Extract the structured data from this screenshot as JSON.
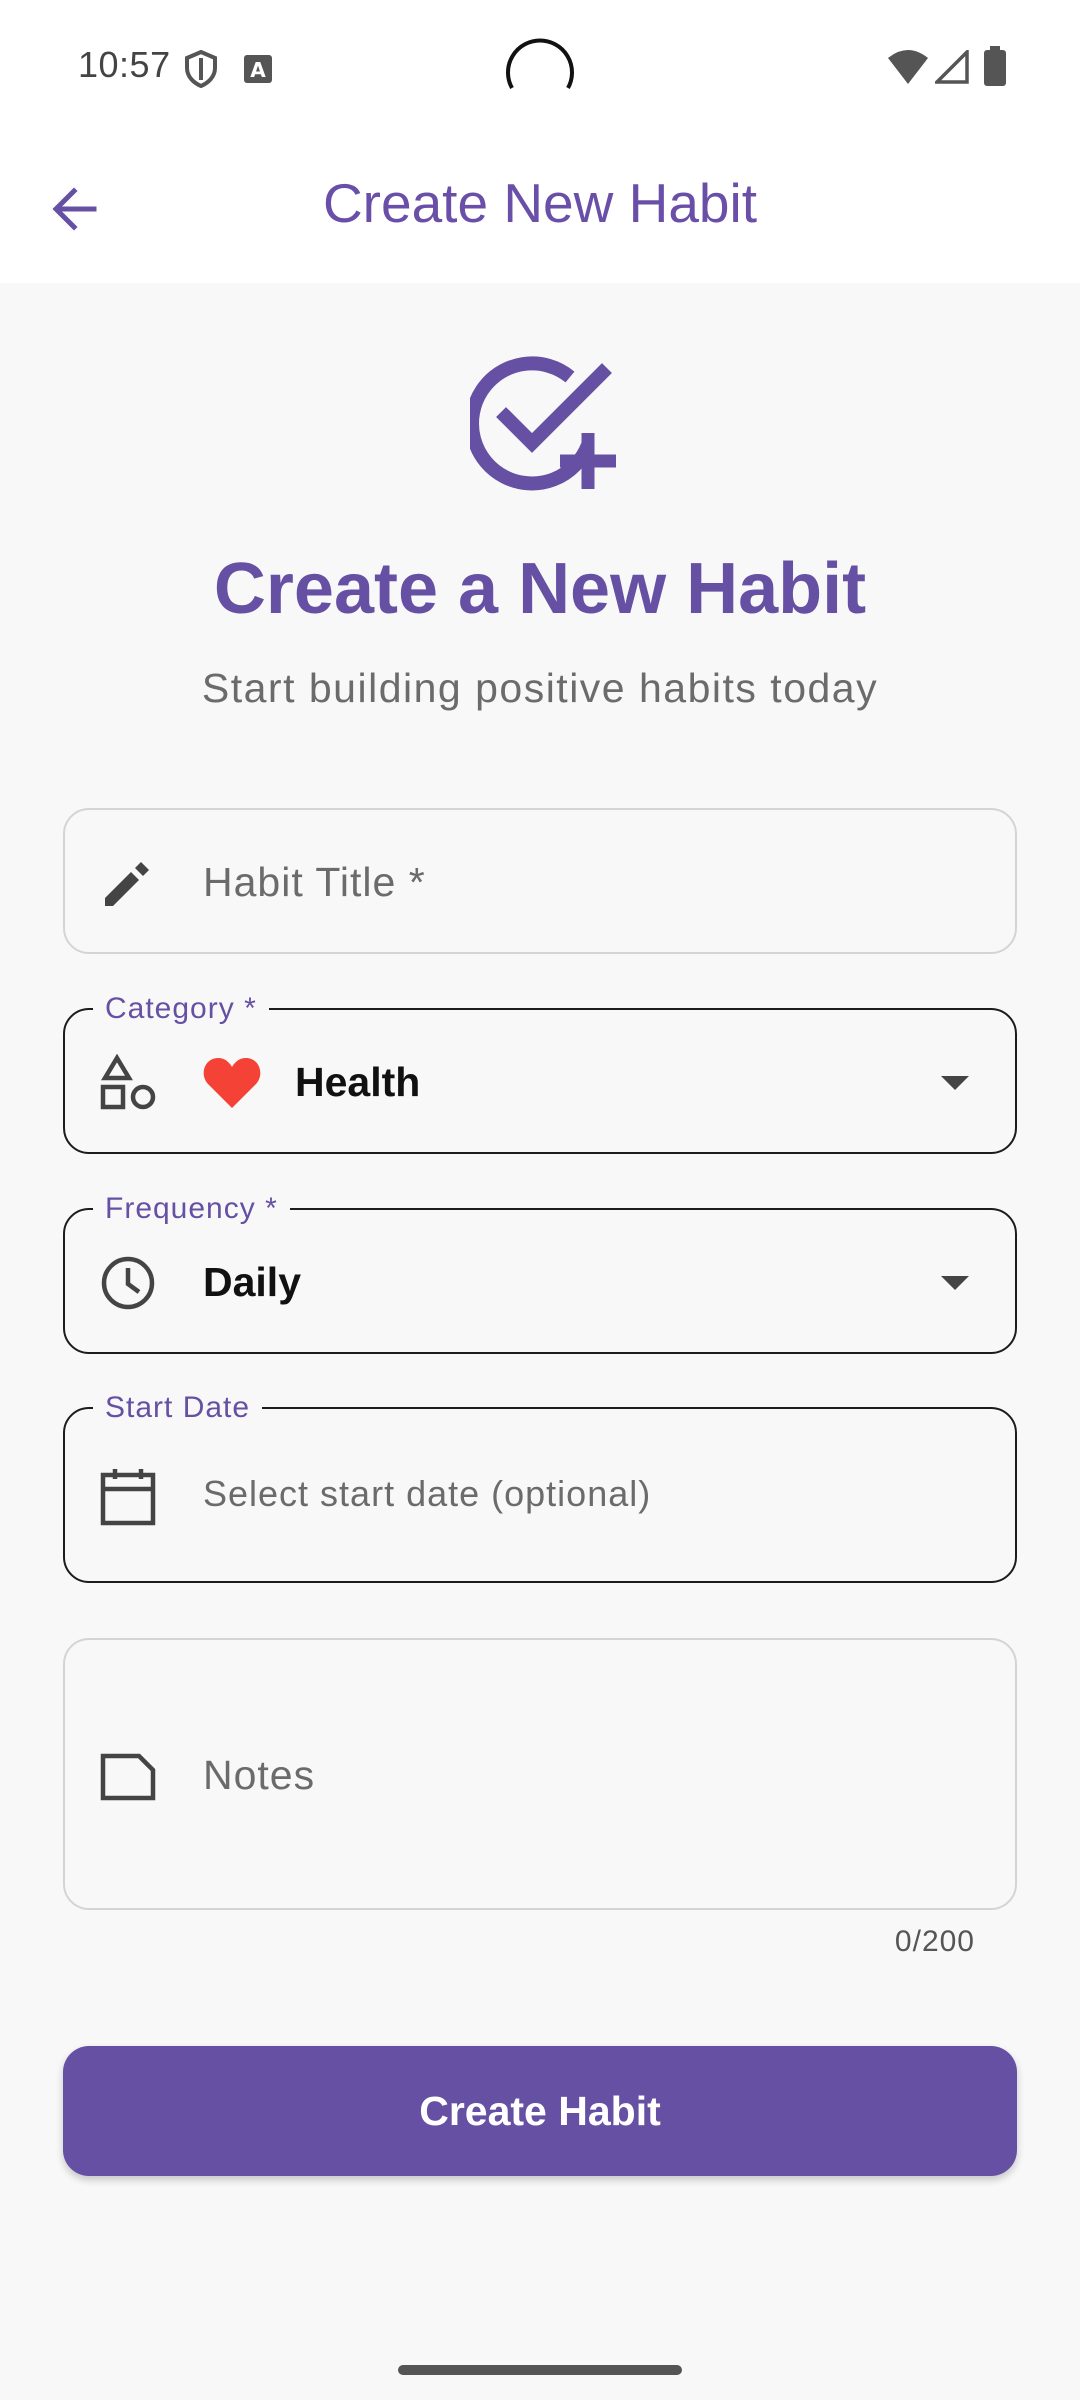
{
  "status_bar": {
    "time": "10:57",
    "icons": [
      "shield-icon",
      "a-badge-icon",
      "wifi-icon",
      "signal-icon",
      "battery-icon"
    ]
  },
  "app_bar": {
    "title": "Create New Habit",
    "back_icon": "arrow-left-icon"
  },
  "hero": {
    "icon": "check-circle-plus-icon",
    "title": "Create a New Habit",
    "subtitle": "Start building positive habits today"
  },
  "form": {
    "habit_title": {
      "placeholder": "Habit Title *",
      "value": "",
      "icon": "pencil-icon"
    },
    "category": {
      "label": "Category *",
      "value": "Health",
      "value_icon": "heart-icon",
      "icon": "shapes-icon"
    },
    "frequency": {
      "label": "Frequency *",
      "value": "Daily",
      "icon": "clock-icon"
    },
    "start_date": {
      "label": "Start Date",
      "placeholder": "Select start date (optional)",
      "icon": "calendar-icon"
    },
    "notes": {
      "placeholder": "Notes",
      "icon": "note-icon",
      "counter": "0/200"
    }
  },
  "submit": {
    "label": "Create Habit"
  },
  "colors": {
    "primary": "#6650a4",
    "heart": "#f44336",
    "background": "#f8f8f8"
  }
}
